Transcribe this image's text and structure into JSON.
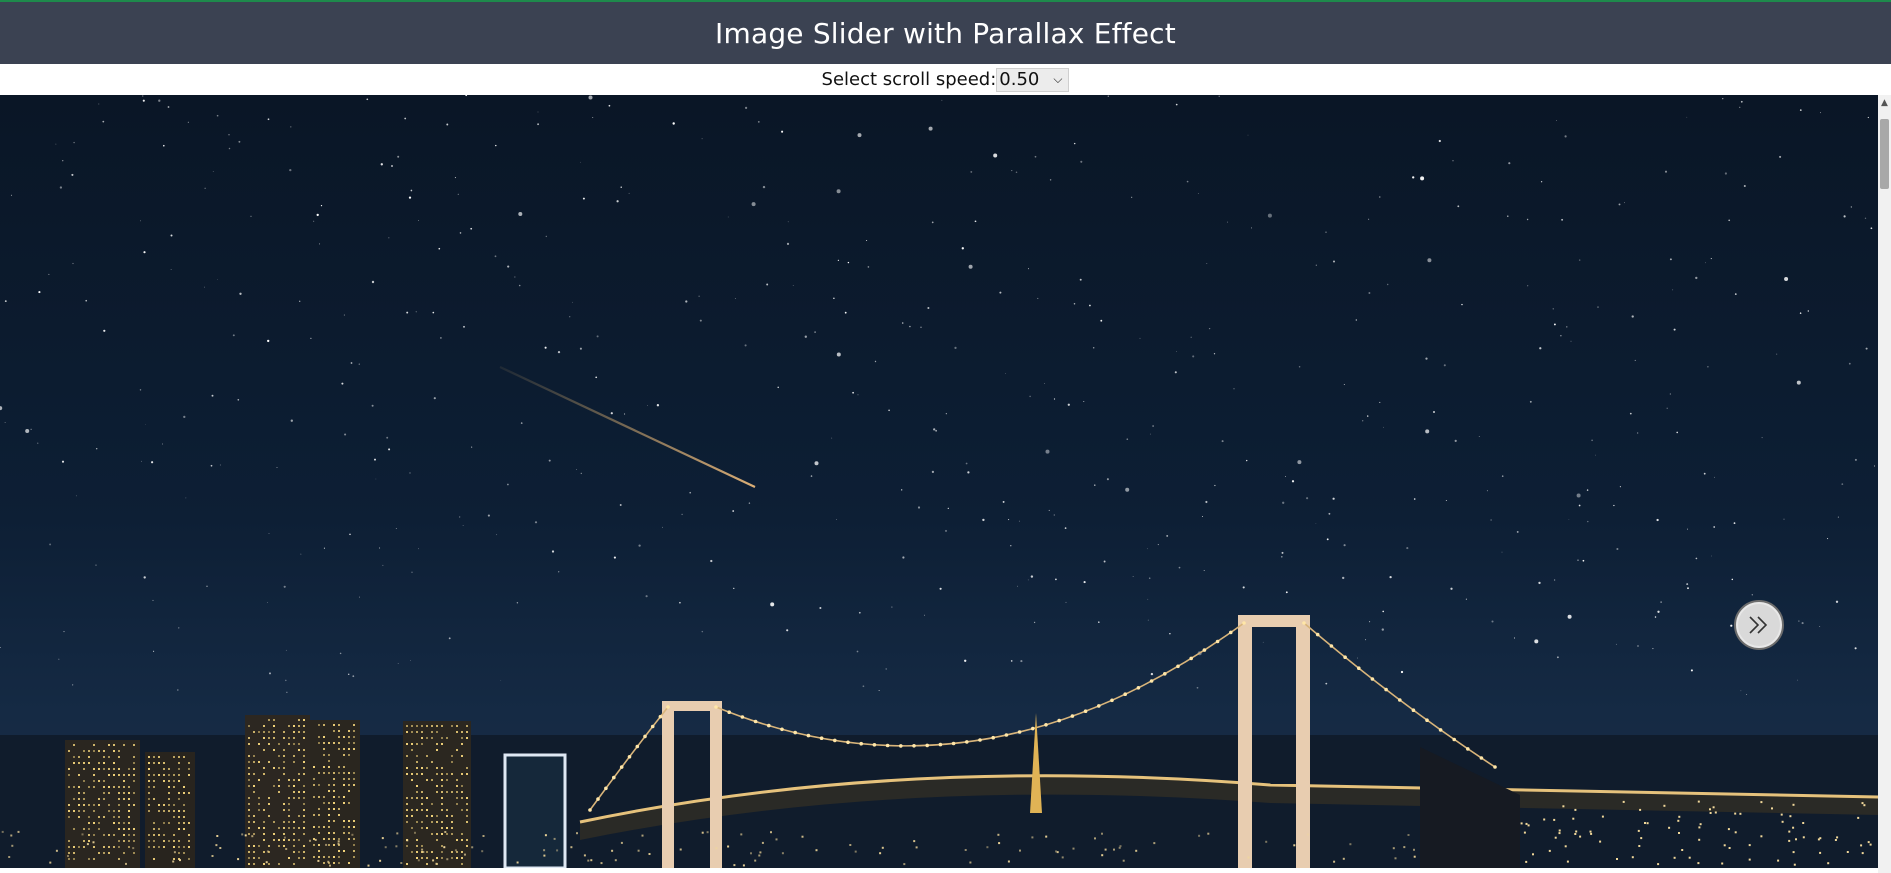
{
  "header": {
    "title": "Image Slider with Parallax Effect"
  },
  "controls": {
    "speed_label": "Select scroll speed:",
    "speed_value": "0.50"
  },
  "slider": {
    "next_icon": "double-chevron-right-icon"
  },
  "colors": {
    "header_bg": "#3b4252",
    "accent_line": "#1e8a4c",
    "sky": "#0b1a2c"
  }
}
